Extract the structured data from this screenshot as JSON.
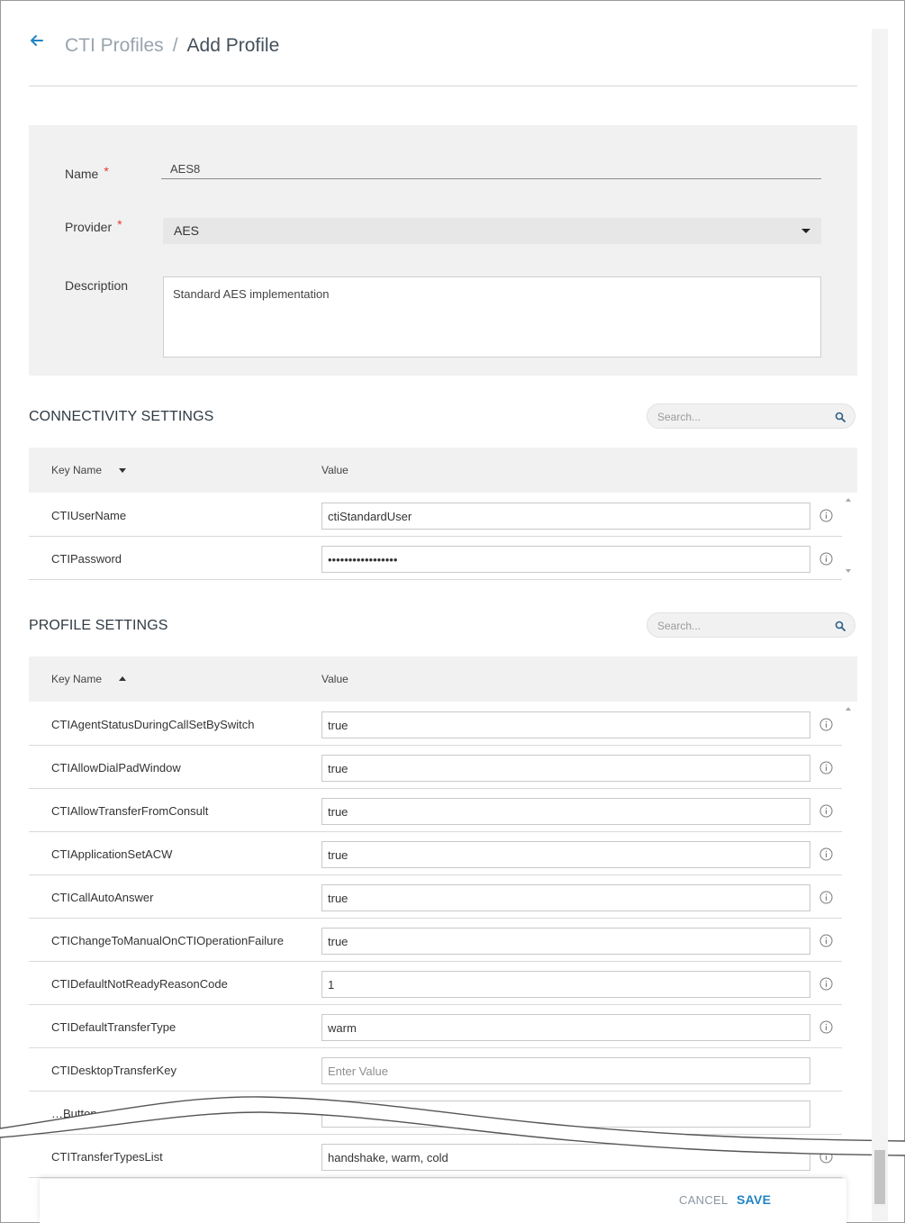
{
  "header": {
    "breadcrumb_parent": "CTI Profiles",
    "breadcrumb_separator": "/",
    "breadcrumb_current": "Add Profile"
  },
  "form": {
    "name_label": "Name",
    "name_value": "AES8",
    "provider_label": "Provider",
    "provider_value": "AES",
    "description_label": "Description",
    "description_value": "Standard AES implementation",
    "required_marker": "*"
  },
  "connectivity": {
    "title": "CONNECTIVITY SETTINGS",
    "search_placeholder": "Search...",
    "col_key": "Key Name",
    "col_value": "Value",
    "rows": [
      {
        "key": "CTIUserName",
        "value": "ctiStandardUser"
      },
      {
        "key": "CTIPassword",
        "value": "•••••••••••••••••"
      }
    ]
  },
  "profile": {
    "title": "PROFILE SETTINGS",
    "search_placeholder": "Search...",
    "col_key": "Key Name",
    "col_value": "Value",
    "rows": [
      {
        "key": "CTIAgentStatusDuringCallSetBySwitch",
        "value": "true"
      },
      {
        "key": "CTIAllowDialPadWindow",
        "value": "true"
      },
      {
        "key": "CTIAllowTransferFromConsult",
        "value": "true"
      },
      {
        "key": "CTIApplicationSetACW",
        "value": "true"
      },
      {
        "key": "CTICallAutoAnswer",
        "value": "true"
      },
      {
        "key": "CTIChangeToManualOnCTIOperationFailure",
        "value": "true"
      },
      {
        "key": "CTIDefaultNotReadyReasonCode",
        "value": "1"
      },
      {
        "key": "CTIDefaultTransferType",
        "value": "warm"
      },
      {
        "key": "CTIDesktopTransferKey",
        "value": "",
        "placeholder": "Enter Value"
      },
      {
        "key": "…Button",
        "value": ""
      },
      {
        "key": "CTITransferTypesList",
        "value": "handshake, warm, cold"
      }
    ]
  },
  "footer": {
    "cancel_label": "CANCEL",
    "save_label": "SAVE"
  },
  "colors": {
    "accent": "#1f84c7",
    "required": "#e53935",
    "panel_bg": "#f1f1f1"
  },
  "icons": {
    "back": "arrow-left-icon",
    "search": "search-icon",
    "info": "info-icon",
    "dropdown": "caret-down-icon"
  }
}
